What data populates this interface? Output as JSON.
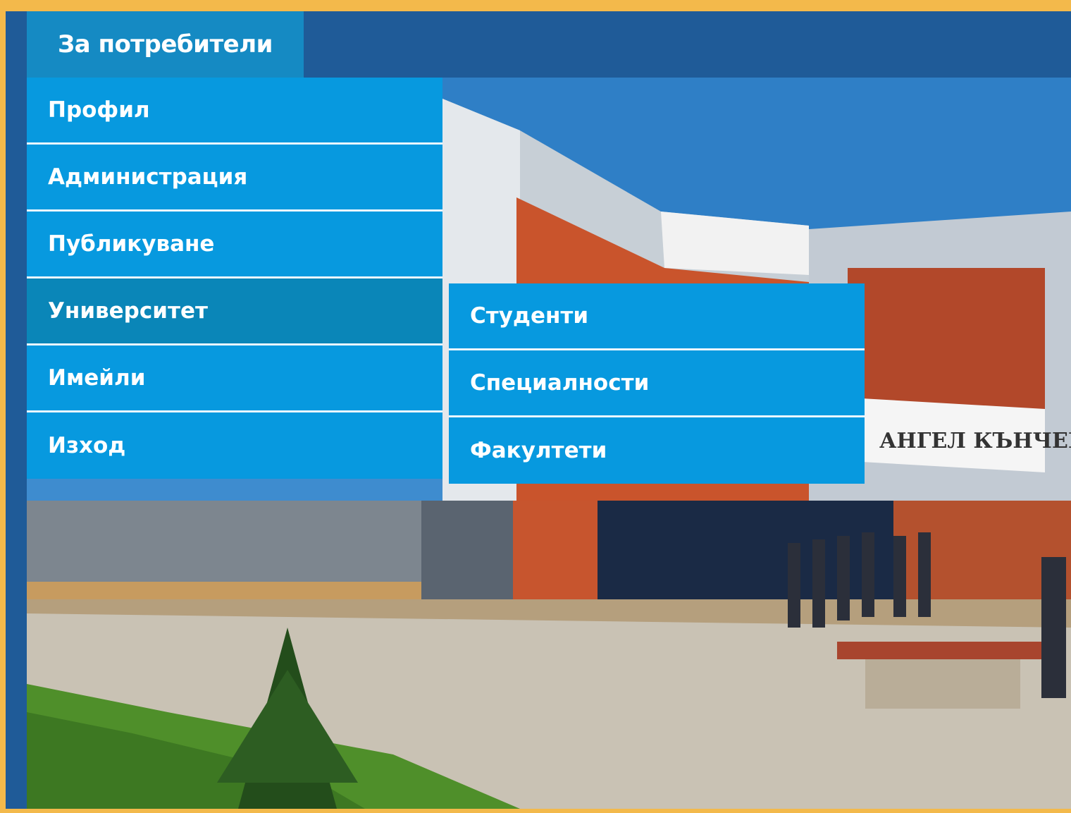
{
  "header": {
    "tab_label": "За потребители"
  },
  "menu": {
    "items": [
      {
        "label": "Профил"
      },
      {
        "label": "Администрация"
      },
      {
        "label": "Публикуване"
      },
      {
        "label": "Университет"
      },
      {
        "label": "Имейли"
      },
      {
        "label": "Изход"
      }
    ],
    "active_index": 3
  },
  "submenu": {
    "items": [
      {
        "label": "Студенти"
      },
      {
        "label": "Специалности"
      },
      {
        "label": "Факултети"
      }
    ]
  },
  "banner": {
    "sign_text": "АНГЕЛ КЪНЧЕВ"
  },
  "colors": {
    "frame": "#1f5b98",
    "border": "#f3b94b",
    "tab": "#158ac3",
    "menu_item": "#0799df",
    "menu_active": "#0a86b8"
  }
}
